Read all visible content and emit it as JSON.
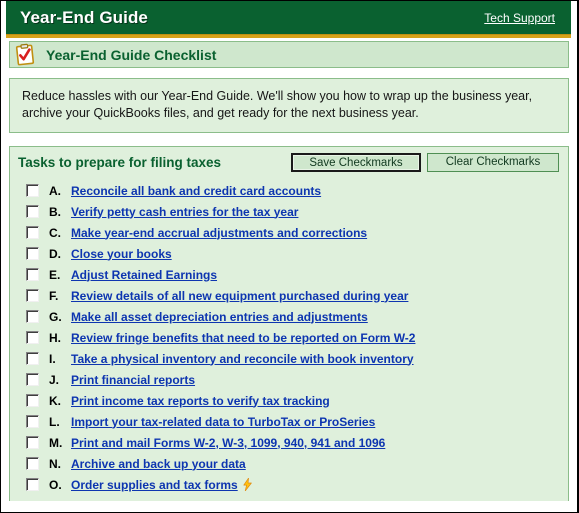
{
  "window": {
    "title": "Year-End Guide",
    "tech_support_label": "Tech Support"
  },
  "banner": {
    "title": "Year-End Guide Checklist",
    "icon": "clipboard-check-icon"
  },
  "intro": {
    "text": "Reduce hassles with our Year-End Guide. We'll show you how to wrap up the business year, archive your QuickBooks files, and get ready for the next business year."
  },
  "tasks": {
    "header": "Tasks to prepare for filing taxes",
    "save_button_label": "Save Checkmarks",
    "clear_button_label": "Clear Checkmarks",
    "items": [
      {
        "letter": "A.",
        "label": "Reconcile all bank and credit card accounts",
        "checked": false,
        "external": false
      },
      {
        "letter": "B.",
        "label": "Verify petty cash entries for the tax year",
        "checked": false,
        "external": false
      },
      {
        "letter": "C.",
        "label": "Make year-end accrual adjustments and corrections",
        "checked": false,
        "external": false
      },
      {
        "letter": "D.",
        "label": "Close your books",
        "checked": false,
        "external": false
      },
      {
        "letter": "E.",
        "label": "Adjust Retained Earnings",
        "checked": false,
        "external": false
      },
      {
        "letter": "F.",
        "label": "Review details of all new equipment purchased during year",
        "checked": false,
        "external": false
      },
      {
        "letter": "G.",
        "label": "Make all asset depreciation entries and adjustments",
        "checked": false,
        "external": false
      },
      {
        "letter": "H.",
        "label": "Review fringe benefits that need to be reported on Form W-2",
        "checked": false,
        "external": false
      },
      {
        "letter": "I.",
        "label": "Take a physical inventory and reconcile with book inventory",
        "checked": false,
        "external": false
      },
      {
        "letter": "J.",
        "label": "Print financial reports",
        "checked": false,
        "external": false
      },
      {
        "letter": "K.",
        "label": "Print income tax reports to verify tax tracking",
        "checked": false,
        "external": false
      },
      {
        "letter": "L.",
        "label": "Import your tax-related data to TurboTax or ProSeries",
        "checked": false,
        "external": false
      },
      {
        "letter": "M.",
        "label": "Print and mail Forms W-2, W-3, 1099, 940, 941 and 1096",
        "checked": false,
        "external": false
      },
      {
        "letter": "N.",
        "label": "Archive and back up your data",
        "checked": false,
        "external": false
      },
      {
        "letter": "O.",
        "label": "Order supplies and tax forms",
        "checked": false,
        "external": true
      }
    ]
  },
  "colors": {
    "header_green": "#0a6130",
    "gold_rule": "#d8a21a",
    "panel_green": "#dff0dc",
    "banner_green": "#cfe7cd",
    "panel_border": "#8bbd8a",
    "link_blue": "#0d35b0",
    "bolt_yellow": "#ffc20e"
  }
}
